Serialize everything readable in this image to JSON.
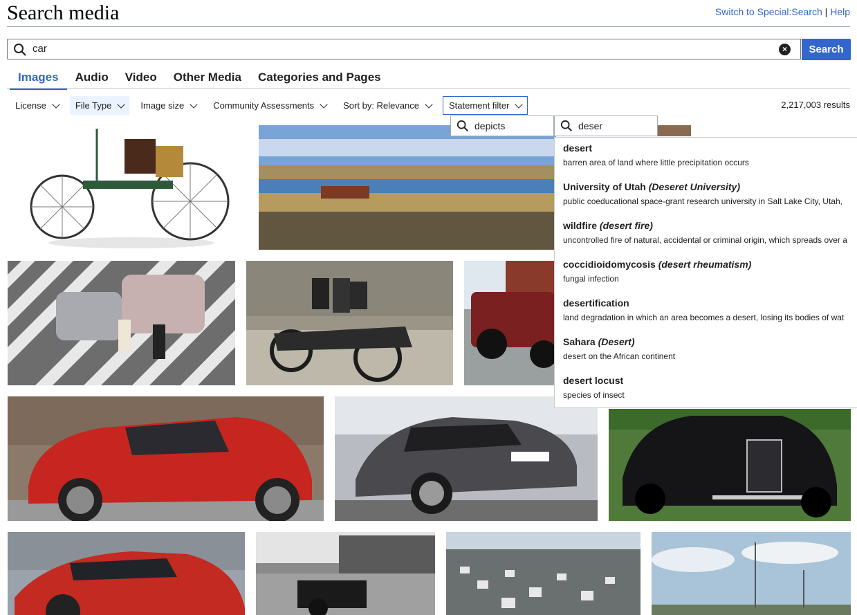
{
  "page": {
    "title": "Search media"
  },
  "toplinks": {
    "switch": "Switch to Special:Search",
    "sep": "|",
    "help": "Help"
  },
  "search": {
    "query": "car",
    "button": "Search"
  },
  "tabs": [
    {
      "label": "Images"
    },
    {
      "label": "Audio"
    },
    {
      "label": "Video"
    },
    {
      "label": "Other Media"
    },
    {
      "label": "Categories and Pages"
    }
  ],
  "filters": {
    "license": "License",
    "file_type": "File Type",
    "image_size": "Image size",
    "community": "Community Assessments",
    "sort": "Sort by: Relevance",
    "statement": "Statement filter"
  },
  "results_count": "2,217,003 results",
  "statement_filter": {
    "property": "depicts",
    "value_query": "deser"
  },
  "suggestions": [
    {
      "label": "desert",
      "alias": "",
      "desc": "barren area of land where little precipitation occurs"
    },
    {
      "label": "University of Utah",
      "alias": "(Deseret University)",
      "desc": "public coeducational space-grant research university in Salt Lake City, Utah,"
    },
    {
      "label": "wildfire",
      "alias": "(desert fire)",
      "desc": "uncontrolled fire of natural, accidental or criminal origin, which spreads over a"
    },
    {
      "label": "coccidioidomycosis",
      "alias": "(desert rheumatism)",
      "desc": "fungal infection"
    },
    {
      "label": "desertification",
      "alias": "",
      "desc": "land degradation in which an area becomes a desert, losing its bodies of wat"
    },
    {
      "label": "Sahara",
      "alias": "(Desert)",
      "desc": "desert on the African continent"
    },
    {
      "label": "desert locust",
      "alias": "",
      "desc": "species of insect"
    }
  ]
}
